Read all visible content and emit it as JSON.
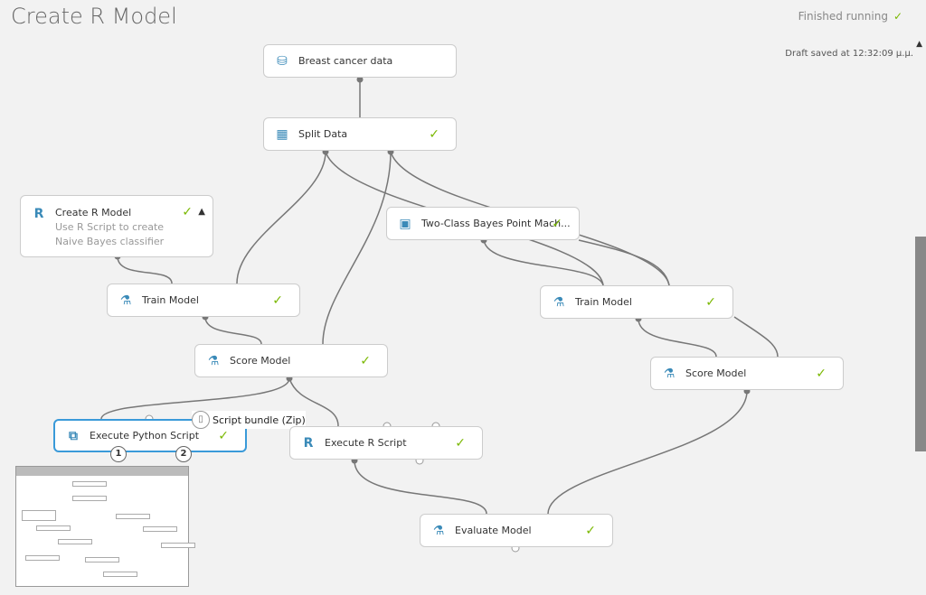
{
  "header": {
    "title": "Create R Model",
    "status": "Finished running",
    "status_icon": "check-icon",
    "draft": "Draft saved at 12:32:09 μ.μ."
  },
  "nodes": {
    "breast": {
      "label": "Breast cancer data",
      "icon": "dataset-icon"
    },
    "split": {
      "label": "Split Data",
      "icon": "split-icon"
    },
    "create_r": {
      "label": "Create R Model",
      "description": "Use R Script to create Naive Bayes classifier",
      "icon": "r-icon"
    },
    "bayes": {
      "label": "Two-Class Bayes Point Mach...",
      "icon": "model-icon"
    },
    "train_l": {
      "label": "Train Model",
      "icon": "train-icon"
    },
    "train_r": {
      "label": "Train Model",
      "icon": "train-icon"
    },
    "score_l": {
      "label": "Score Model",
      "icon": "score-icon"
    },
    "score_r": {
      "label": "Score Model",
      "icon": "score-icon"
    },
    "python": {
      "label": "Execute Python Script",
      "icon": "python-icon",
      "ports": [
        "1",
        "2"
      ]
    },
    "exec_r": {
      "label": "Execute R Script",
      "icon": "r-icon"
    },
    "evaluate": {
      "label": "Evaluate Model",
      "icon": "evaluate-icon"
    }
  },
  "tooltip": "Script bundle (Zip)",
  "colors": {
    "accent": "#3a9ad9",
    "success": "#7ab800"
  }
}
